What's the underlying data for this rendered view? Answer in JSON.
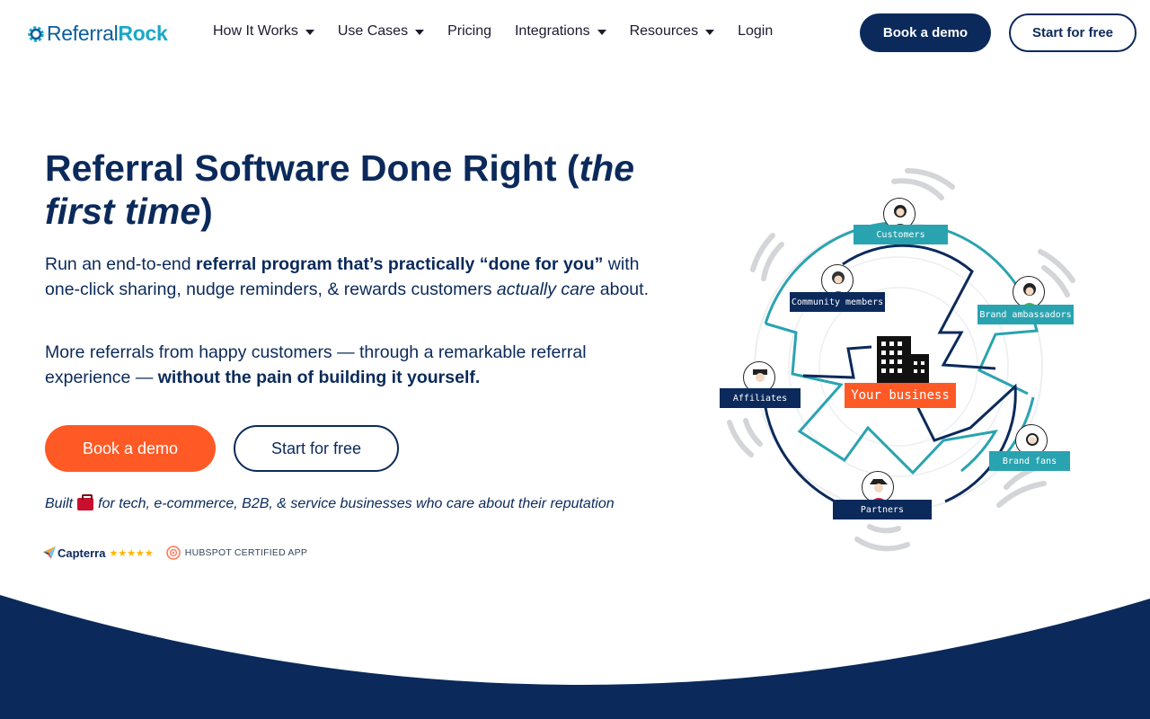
{
  "nav": {
    "logo": {
      "part1": "Referral",
      "part2": "Rock"
    },
    "links": [
      {
        "label": "How It Works",
        "dropdown": true
      },
      {
        "label": "Use Cases",
        "dropdown": true
      },
      {
        "label": "Pricing",
        "dropdown": false
      },
      {
        "label": "Integrations",
        "dropdown": true
      },
      {
        "label": "Resources",
        "dropdown": true
      },
      {
        "label": "Login",
        "dropdown": false
      }
    ],
    "book_demo": "Book a demo",
    "start_free": "Start for free"
  },
  "hero": {
    "title_main": "Referral Software Done Right (",
    "title_italic": "the first time",
    "title_end": ")",
    "p1": {
      "a": "Run an end-to-end ",
      "b": "referral program that’s practically “done for you”",
      "c": " with one-click sharing, nudge reminders, & rewards customers ",
      "d": "actually care",
      "e": " about."
    },
    "p2": {
      "a": "More referrals from happy customers — through a remarkable referral experience — ",
      "b": "without the pain of building it yourself."
    },
    "book_demo": "Book a demo",
    "start_free": "Start for free",
    "built_before": "Built",
    "built_after": "for tech, e-commerce, B2B, & service businesses who care about their reputation",
    "capterra": "Capterra",
    "stars": "★★★★★",
    "hubspot": "HUBSPOT CERTIFIED APP"
  },
  "diagram": {
    "center": "Your business",
    "nodes": {
      "customers": "Customers",
      "community": "Community members",
      "ambassadors": "Brand ambassadors",
      "affiliates": "Affiliates",
      "fans": "Brand fans",
      "partners": "Partners"
    }
  },
  "colors": {
    "navy": "#0b2a5b",
    "orange": "#ff5a26",
    "teal": "#2aa3b0"
  }
}
